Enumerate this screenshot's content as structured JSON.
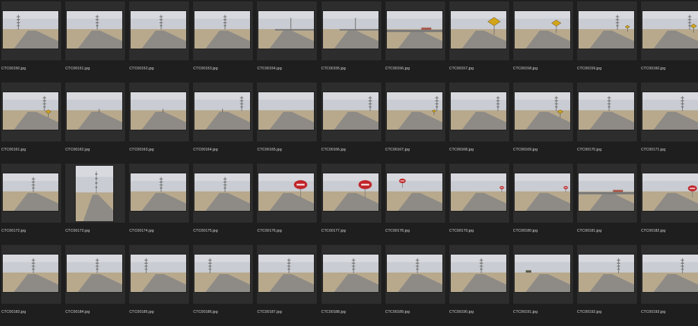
{
  "files": [
    {
      "name": "CTC00150.jpg",
      "scene": "tower-left",
      "orientation": "landscape"
    },
    {
      "name": "CTC00151.jpg",
      "scene": "tower-center",
      "orientation": "landscape"
    },
    {
      "name": "CTC00152.jpg",
      "scene": "tower-center",
      "orientation": "landscape"
    },
    {
      "name": "CTC00153.jpg",
      "scene": "tower-center",
      "orientation": "landscape"
    },
    {
      "name": "CTC00154.jpg",
      "scene": "crossroad-pole",
      "orientation": "landscape"
    },
    {
      "name": "CTC00155.jpg",
      "scene": "crossroad-pole",
      "orientation": "landscape"
    },
    {
      "name": "CTC00156.jpg",
      "scene": "crossroad-flat",
      "orientation": "landscape"
    },
    {
      "name": "CTC00157.jpg",
      "scene": "curve-sign-big",
      "orientation": "landscape"
    },
    {
      "name": "CTC00158.jpg",
      "scene": "curve-sign",
      "orientation": "landscape"
    },
    {
      "name": "CTC00159.jpg",
      "scene": "curve-sign-far",
      "orientation": "landscape"
    },
    {
      "name": "CTC00160.jpg",
      "scene": "curve-sign-right",
      "orientation": "landscape"
    },
    {
      "name": "CTC00161.jpg",
      "scene": "tower-sign",
      "orientation": "landscape"
    },
    {
      "name": "CTC00162.jpg",
      "scene": "field-post",
      "orientation": "landscape"
    },
    {
      "name": "CTC00163.jpg",
      "scene": "field-post",
      "orientation": "landscape"
    },
    {
      "name": "CTC00164.jpg",
      "scene": "field-post-tower",
      "orientation": "landscape"
    },
    {
      "name": "CTC00165.jpg",
      "scene": "road-empty",
      "orientation": "landscape"
    },
    {
      "name": "CTC00166.jpg",
      "scene": "road-tower-right",
      "orientation": "landscape"
    },
    {
      "name": "CTC00167.jpg",
      "scene": "road-sign-right",
      "orientation": "landscape"
    },
    {
      "name": "CTC00168.jpg",
      "scene": "road-tower-right",
      "orientation": "landscape"
    },
    {
      "name": "CTC00169.jpg",
      "scene": "tower-sign",
      "orientation": "landscape"
    },
    {
      "name": "CTC00170.jpg",
      "scene": "tower-center",
      "orientation": "landscape"
    },
    {
      "name": "CTC00171.jpg",
      "scene": "tower-right",
      "orientation": "landscape"
    },
    {
      "name": "CTC00172.jpg",
      "scene": "tower-center",
      "orientation": "landscape"
    },
    {
      "name": "CTC00173.jpg",
      "scene": "tower-center",
      "orientation": "portrait"
    },
    {
      "name": "CTC00174.jpg",
      "scene": "tower-center",
      "orientation": "landscape"
    },
    {
      "name": "CTC00175.jpg",
      "scene": "tower-center",
      "orientation": "landscape"
    },
    {
      "name": "CTC00176.jpg",
      "scene": "stop-big",
      "orientation": "landscape"
    },
    {
      "name": "CTC00177.jpg",
      "scene": "stop-big",
      "orientation": "landscape"
    },
    {
      "name": "CTC00178.jpg",
      "scene": "stop-left",
      "orientation": "landscape"
    },
    {
      "name": "CTC00179.jpg",
      "scene": "stop-small",
      "orientation": "landscape"
    },
    {
      "name": "CTC00180.jpg",
      "scene": "stop-small",
      "orientation": "landscape"
    },
    {
      "name": "CTC00181.jpg",
      "scene": "crossroad-flat",
      "orientation": "landscape"
    },
    {
      "name": "CTC00182.jpg",
      "scene": "stop-right",
      "orientation": "landscape"
    },
    {
      "name": "CTC00183.jpg",
      "scene": "tower-center",
      "orientation": "landscape"
    },
    {
      "name": "CTC00184.jpg",
      "scene": "tower-center",
      "orientation": "landscape"
    },
    {
      "name": "CTC00185.jpg",
      "scene": "tower-left",
      "orientation": "landscape"
    },
    {
      "name": "CTC00186.jpg",
      "scene": "tower-left",
      "orientation": "landscape"
    },
    {
      "name": "CTC00187.jpg",
      "scene": "tower-center",
      "orientation": "landscape"
    },
    {
      "name": "CTC00188.jpg",
      "scene": "tower-center",
      "orientation": "landscape"
    },
    {
      "name": "CTC00189.jpg",
      "scene": "tower-center",
      "orientation": "landscape"
    },
    {
      "name": "CTC00190.jpg",
      "scene": "tower-center",
      "orientation": "landscape"
    },
    {
      "name": "CTC00191.jpg",
      "scene": "dirt-road",
      "orientation": "landscape"
    },
    {
      "name": "CTC00192.jpg",
      "scene": "tower-right",
      "orientation": "landscape"
    },
    {
      "name": "CTC00193.jpg",
      "scene": "tower-right",
      "orientation": "landscape"
    }
  ]
}
